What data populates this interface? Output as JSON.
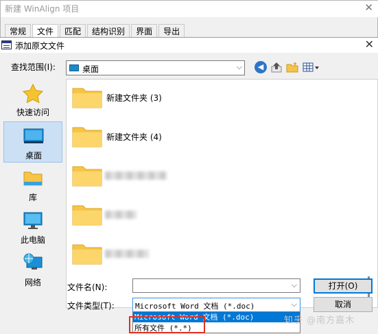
{
  "app": {
    "title": "新建 WinAlign 项目",
    "tabs": [
      "常规",
      "文件",
      "匹配",
      "结构识别",
      "界面",
      "导出"
    ],
    "active_tab": 1
  },
  "dialog": {
    "title": "添加原文文件",
    "look_in_label": "查找范围(I):",
    "look_in_value": "桌面",
    "places": [
      {
        "label": "快速访问",
        "icon": "star-icon"
      },
      {
        "label": "桌面",
        "icon": "desktop-icon"
      },
      {
        "label": "库",
        "icon": "library-icon"
      },
      {
        "label": "此电脑",
        "icon": "computer-icon"
      },
      {
        "label": "网络",
        "icon": "network-icon"
      }
    ],
    "active_place": 1,
    "files": [
      {
        "name": "新建文件夹 (3)"
      },
      {
        "name": "新建文件夹 (4)"
      },
      {
        "name": ""
      },
      {
        "name": ""
      },
      {
        "name": ""
      }
    ],
    "filename_label": "文件名(N):",
    "filename_value": "",
    "filetype_label": "文件类型(T):",
    "filetype_value": "Microsoft Word 文档 (*.doc)",
    "filetype_options": [
      "Microsoft Word 文档 (*.doc)",
      "所有文件 (*.*)"
    ],
    "open_label": "打开(O)",
    "cancel_label": "取消"
  },
  "watermark": "知乎 @南方嘉木",
  "colors": {
    "selection": "#0078d7",
    "highlight_box": "#e03020",
    "folder": "#f7c545"
  }
}
